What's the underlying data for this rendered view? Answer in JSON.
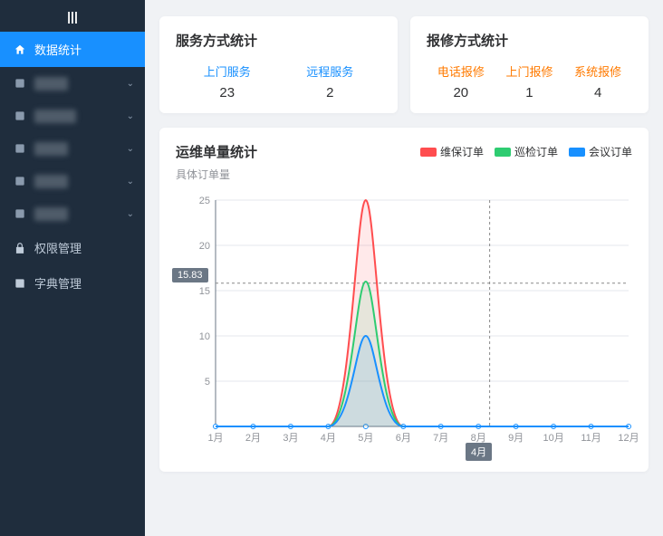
{
  "logo": "|||",
  "sidebar": {
    "active": {
      "label": "数据统计"
    },
    "blurred": [
      {
        "label": "████"
      },
      {
        "label": "█████"
      },
      {
        "label": "████"
      },
      {
        "label": "████"
      },
      {
        "label": "████"
      }
    ],
    "perm": {
      "label": "权限管理"
    },
    "dict": {
      "label": "字典管理"
    }
  },
  "cards": {
    "service": {
      "title": "服务方式统计",
      "stats": [
        {
          "label": "上门服务",
          "value": "23",
          "color": "blue"
        },
        {
          "label": "远程服务",
          "value": "2",
          "color": "blue"
        }
      ]
    },
    "repair": {
      "title": "报修方式统计",
      "stats": [
        {
          "label": "电话报修",
          "value": "20",
          "color": "orange"
        },
        {
          "label": "上门报修",
          "value": "1",
          "color": "orange"
        },
        {
          "label": "系统报修",
          "value": "4",
          "color": "orange"
        }
      ]
    }
  },
  "chart": {
    "title": "运维单量统计",
    "subtitle": "具体订单量",
    "legend": [
      {
        "name": "维保订单",
        "color": "#ff4d4f"
      },
      {
        "name": "巡检订单",
        "color": "#2ecc71"
      },
      {
        "name": "会议订单",
        "color": "#1890ff"
      }
    ],
    "tooltip_y": "15.83",
    "tooltip_x": "4月"
  },
  "chart_data": {
    "type": "line",
    "categories": [
      "1月",
      "2月",
      "3月",
      "4月",
      "5月",
      "6月",
      "7月",
      "8月",
      "9月",
      "10月",
      "11月",
      "12月"
    ],
    "series": [
      {
        "name": "维保订单",
        "color": "#ff4d4f",
        "values": [
          0,
          0,
          0,
          0,
          25,
          0,
          0,
          0,
          0,
          0,
          0,
          0
        ]
      },
      {
        "name": "巡检订单",
        "color": "#2ecc71",
        "values": [
          0,
          0,
          0,
          0,
          16,
          0,
          0,
          0,
          0,
          0,
          0,
          0
        ]
      },
      {
        "name": "会议订单",
        "color": "#1890ff",
        "values": [
          0,
          0,
          0,
          0,
          10,
          0,
          0,
          0,
          0,
          0,
          0,
          0
        ]
      }
    ],
    "ylim": [
      0,
      25
    ],
    "yticks": [
      5,
      10,
      15,
      20,
      25
    ],
    "xlabel": "",
    "ylabel": "",
    "title": "运维单量统计"
  }
}
